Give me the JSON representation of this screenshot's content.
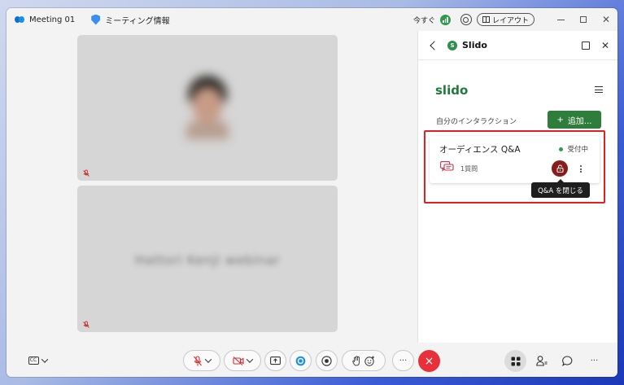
{
  "titlebar": {
    "meeting_title": "Meeting 01",
    "meeting_info": "ミーティング情報",
    "now_label": "今すぐ",
    "layout_label": "レイアウト"
  },
  "video": {
    "participant_name_blurred": "Hattori Kenji webinar"
  },
  "panel": {
    "title": "Slido",
    "logo": "slido",
    "interactions_label": "自分のインタラクション",
    "add_button": "追加...",
    "card": {
      "title": "オーディエンス Q&A",
      "status": "受付中",
      "count": "1質問"
    },
    "tooltip": "Q&A を閉じる"
  },
  "toolbar": {
    "cc_label": "CC",
    "more_label": "···",
    "end_call_icon": "×"
  },
  "colors": {
    "accent_green": "#2e7d3b",
    "status_green": "#2e9d4a",
    "highlight_red": "#e02020",
    "end_call_red": "#e8303a",
    "lock_dark_red": "#8b1c1c"
  }
}
